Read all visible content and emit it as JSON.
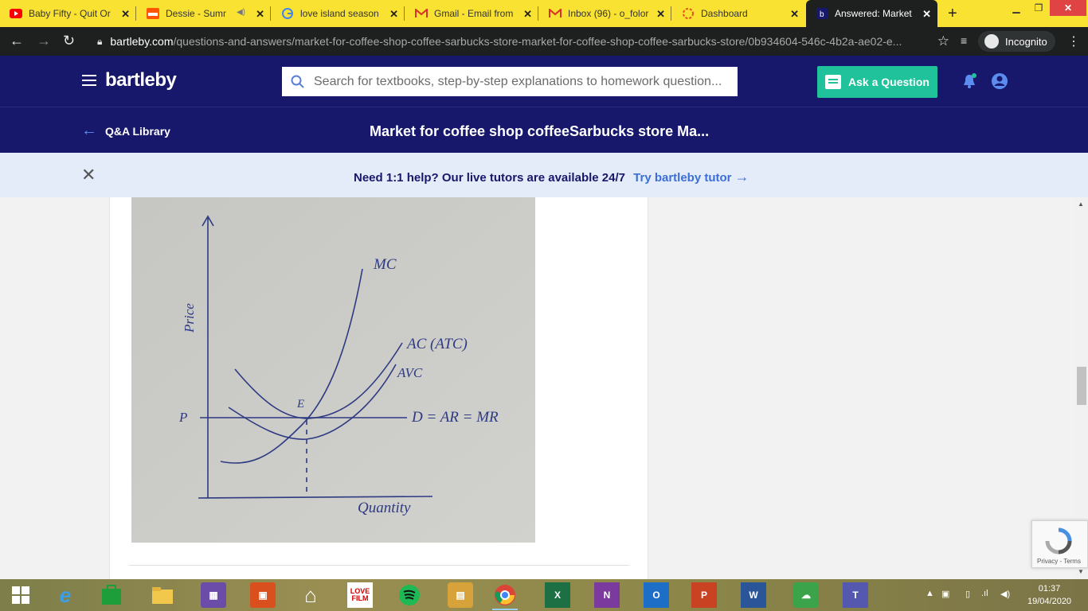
{
  "tabs": [
    {
      "title": "Baby Fifty - Quit Or",
      "icon": "youtube-icon",
      "color": "#ff0000"
    },
    {
      "title": "Dessie - Summ",
      "icon": "soundcloud-icon",
      "color": "#ff5500"
    },
    {
      "title": "love island season",
      "icon": "google-icon",
      "color": "#4285f4"
    },
    {
      "title": "Gmail - Email from",
      "icon": "gmail-icon",
      "color": "#d93025"
    },
    {
      "title": "Inbox (96) - o_folor",
      "icon": "gmail-icon",
      "color": "#d93025"
    },
    {
      "title": "Dashboard",
      "icon": "dashboard-icon",
      "color": "#e84c1e"
    },
    {
      "title": "Answered: Market f",
      "icon": "bartleby-icon",
      "color": "#17186b",
      "active": true
    }
  ],
  "addressbar": {
    "host": "bartleby.com",
    "path": "/questions-and-answers/market-for-coffee-shop-coffee-sarbucks-store-market-for-coffee-shop-coffee-sarbucks-store/0b934604-546c-4b2a-ae02-e...",
    "incognito": "Incognito"
  },
  "header": {
    "logo": "bartleby",
    "search_placeholder": "Search for textbooks, step-by-step explanations to homework question...",
    "ask_label": "Ask a Question"
  },
  "subheader": {
    "back_label": "Q&A Library",
    "title": "Market for coffee shop coffeeSarbucks store Ma..."
  },
  "banner": {
    "message": "Need 1:1 help? Our live tutors are available 24/7",
    "link": "Try bartleby tutor"
  },
  "figure": {
    "y_axis": "Price",
    "x_axis": "Quantity",
    "price_label": "P",
    "point_label": "E",
    "mc": "MC",
    "ac": "AC (ATC)",
    "avc": "AVC",
    "demand": "D = AR = MR"
  },
  "recaptcha": {
    "text": "Privacy - Terms"
  },
  "taskbar": {
    "apps": [
      "windows-start-icon",
      "internet-explorer-icon",
      "store-icon",
      "file-explorer-icon",
      "photos-app-icon",
      "photos-icon",
      "home-icon",
      "love-film-icon",
      "spotify-icon",
      "ibooks-icon",
      "chrome-icon",
      "excel-icon",
      "onenote-icon",
      "outlook-icon",
      "powerpoint-icon",
      "word-icon",
      "cloud-app-icon",
      "teams-icon"
    ],
    "love_film": "LOVE FILM",
    "time": "01:37",
    "date": "19/04/2020"
  }
}
